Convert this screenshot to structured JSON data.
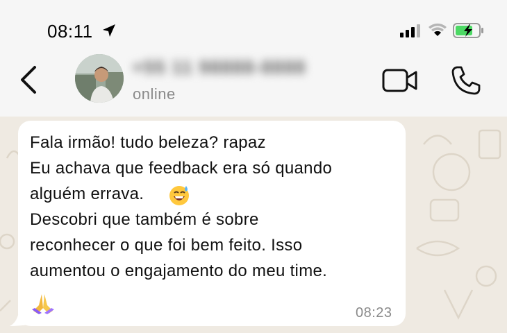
{
  "status_bar": {
    "time": "08:11",
    "icons": [
      "location-arrow-icon",
      "cellular-signal-icon",
      "wifi-icon",
      "battery-charging-icon"
    ],
    "battery_color": "#4cd964"
  },
  "header": {
    "back_icon": "chevron-left-icon",
    "contact_name": "+55 11 98888-8888",
    "presence": "online",
    "actions": [
      "video-call-icon",
      "phone-call-icon"
    ]
  },
  "message": {
    "lines": [
      "Fala irmão! tudo beleza? rapaz",
      "Eu achava que feedback era só quando",
      "alguém errava.",
      "Descobri que também é sobre",
      "reconhecer o que foi bem feito. Isso",
      "aumentou o engajamento do meu time."
    ],
    "emojis": [
      "grinning-sweat-emoji",
      "folded-hands-emoji"
    ],
    "time": "08:23"
  },
  "colors": {
    "chat_background": "#efeae2",
    "bubble": "#ffffff",
    "header": "#f6f6f6"
  }
}
